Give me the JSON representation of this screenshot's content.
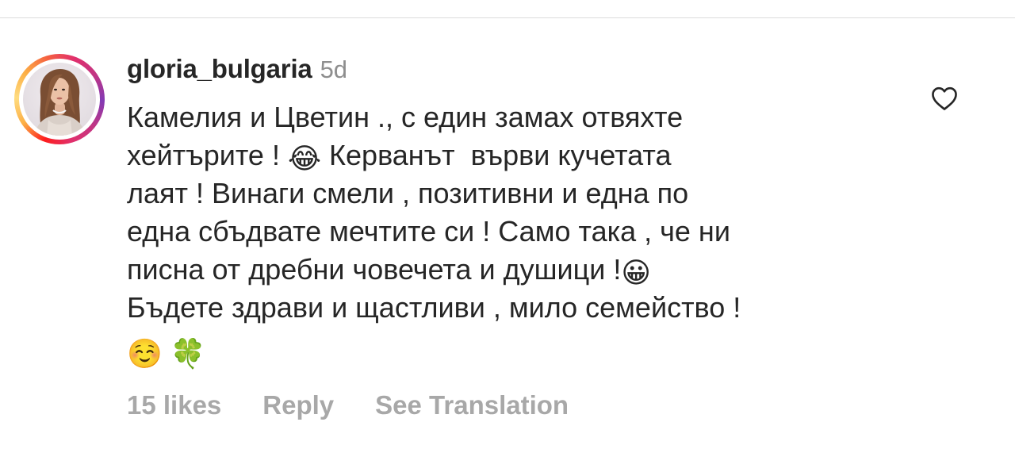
{
  "comment": {
    "username": "gloria_bulgaria",
    "timestamp": "5d",
    "avatar_icon": "profile-photo",
    "ring_colors": [
      "#fd1d1d",
      "#fcaf45",
      "#e1306c",
      "#833ab4"
    ],
    "lines": [
      {
        "text": "Камелия и Цветин ., с един замах отвяхте"
      },
      {
        "text_before": "хейтърите ! ",
        "emoji": "😂",
        "text_after": " Керванът  върви кучетата"
      },
      {
        "text": "лаят ! Винаги смели , позитивни и една по"
      },
      {
        "text": "една сбъдвате мечтите си ! Само така , че ни"
      },
      {
        "text_before": "писна от дребни човечета и душици !",
        "emoji": "😀"
      },
      {
        "text": "Бъдете здрави и щастливи , мило семейство !"
      },
      {
        "emoji_1": "☺️",
        "emoji_2": "🍀"
      }
    ],
    "likes": "15 likes",
    "reply_label": "Reply",
    "translation_label": "See Translation",
    "like_icon": "heart-outline-icon"
  },
  "colors": {
    "username": "#262626",
    "secondary_text": "#8e8e8e",
    "action_text": "#a8a8a8",
    "divider": "#dbdbdb"
  }
}
